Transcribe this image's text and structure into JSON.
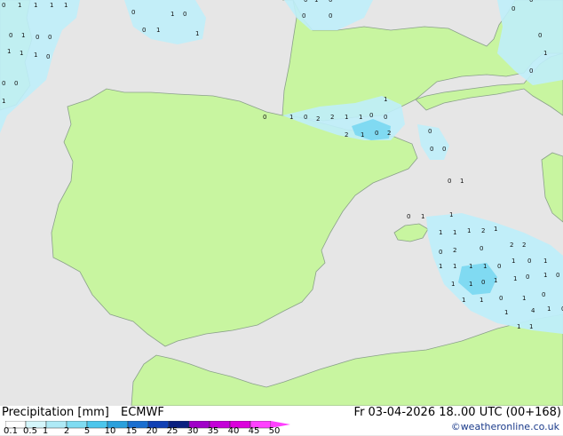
{
  "header": {
    "legend_title": "Precipitation [mm]",
    "model": "ECMWF",
    "valid_time": "Fr 03-04-2026 18..00 UTC (00+168)",
    "credit": "©weatheronline.co.uk"
  },
  "colors": {
    "sea": "#e6e6e6",
    "land": "#c8f5a0",
    "coast": "#8aa08a",
    "precip_light": "#bfeefa",
    "precip_mid": "#80daf2",
    "precip_strong": "#3cb8e8"
  },
  "legend": {
    "ticks": [
      "0.1",
      "0.5",
      "1",
      "2",
      "5",
      "10",
      "15",
      "20",
      "25",
      "30",
      "35",
      "40",
      "45",
      "50"
    ],
    "colors": [
      "#fefefe",
      "#d4f6fb",
      "#aeeaf6",
      "#7fdcf2",
      "#4cc6ec",
      "#2aa0dc",
      "#1a6fd0",
      "#1040b4",
      "#0a2080",
      "#a000c8",
      "#c400d8",
      "#dc00dc",
      "#ff40ff"
    ]
  },
  "precip_values": [
    "0",
    "1",
    "1",
    "1",
    "1",
    "0",
    "1",
    "0",
    "0",
    "1",
    "0",
    "0",
    "0",
    "0",
    "1",
    "0",
    "0",
    "1",
    "1",
    "1",
    "0",
    "0",
    "1",
    "1",
    "0",
    "0",
    "0",
    "0",
    "1",
    "0",
    "0",
    "1",
    "0",
    "1",
    "0",
    "2",
    "2",
    "1",
    "1",
    "0",
    "0",
    "1",
    "2",
    "1",
    "0",
    "2",
    "0",
    "0",
    "0",
    "0",
    "1",
    "0",
    "1",
    "1",
    "1",
    "1",
    "1",
    "2",
    "1",
    "2",
    "2",
    "0",
    "2",
    "0",
    "1",
    "0",
    "1",
    "1",
    "1",
    "1",
    "1",
    "0",
    "1",
    "1",
    "0",
    "1",
    "1",
    "0",
    "1",
    "0",
    "1",
    "1",
    "0",
    "1",
    "0",
    "1",
    "4",
    "1",
    "0",
    "1",
    "1"
  ]
}
